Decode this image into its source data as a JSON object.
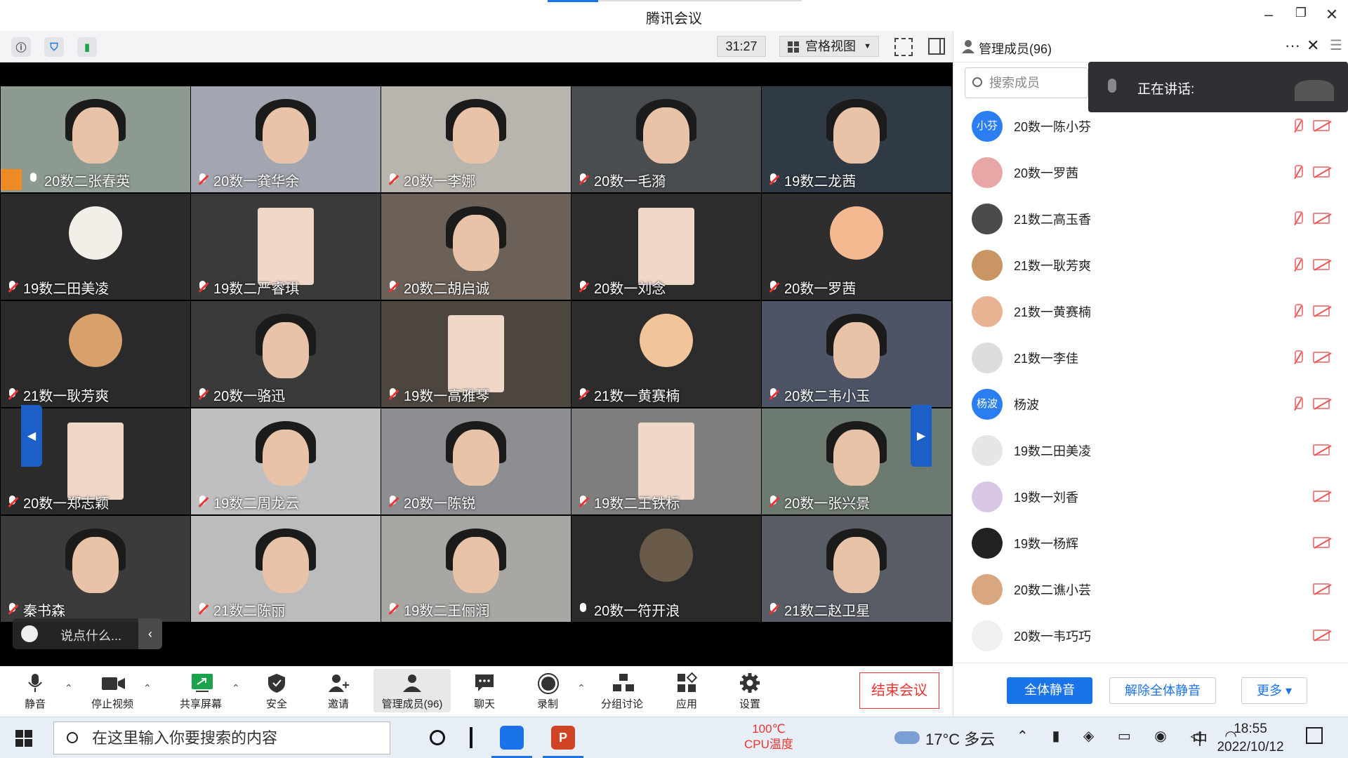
{
  "window": {
    "title": "腾讯会议",
    "min": "–",
    "max": "❐",
    "close": "✕"
  },
  "toolbar": {
    "timer": "31:27",
    "view_label": "宫格视图"
  },
  "tiles": [
    {
      "name": "20数二张春英",
      "mic": "on"
    },
    {
      "name": "20数一龚华余",
      "mic": "off"
    },
    {
      "name": "20数一李娜",
      "mic": "off"
    },
    {
      "name": "20数一毛漪",
      "mic": "off"
    },
    {
      "name": "19数二龙茜",
      "mic": "off"
    },
    {
      "name": "19数二田美凌",
      "mic": "off"
    },
    {
      "name": "19数二严睿琪",
      "mic": "off"
    },
    {
      "name": "20数二胡启诚",
      "mic": "off"
    },
    {
      "name": "20数一刘念",
      "mic": "off"
    },
    {
      "name": "20数一罗茜",
      "mic": "off"
    },
    {
      "name": "21数一耿芳爽",
      "mic": "off"
    },
    {
      "name": "20数一骆迅",
      "mic": "off"
    },
    {
      "name": "19数一高雅琴",
      "mic": "off"
    },
    {
      "name": "21数一黄赛楠",
      "mic": "off"
    },
    {
      "name": "20数二韦小玉",
      "mic": "off"
    },
    {
      "name": "20数一郑志颖",
      "mic": "off"
    },
    {
      "name": "19数二周龙云",
      "mic": "off"
    },
    {
      "name": "20数一陈锐",
      "mic": "off"
    },
    {
      "name": "19数二王铁标",
      "mic": "off"
    },
    {
      "name": "20数一张兴景",
      "mic": "off"
    },
    {
      "name": "秦书森",
      "mic": "off"
    },
    {
      "name": "21数二陈丽",
      "mic": "off"
    },
    {
      "name": "19数二王俪润",
      "mic": "off"
    },
    {
      "name": "20数一符开浪",
      "mic": "on"
    },
    {
      "name": "21数二赵卫星",
      "mic": "off"
    }
  ],
  "chat": {
    "placeholder": "说点什么..."
  },
  "controls": {
    "mute": "静音",
    "stop_video": "停止视频",
    "share": "共享屏幕",
    "security": "安全",
    "invite": "邀请",
    "members": "管理成员(96)",
    "chat": "聊天",
    "record": "录制",
    "breakout": "分组讨论",
    "apps": "应用",
    "settings": "设置",
    "end": "结束会议"
  },
  "panel": {
    "title": "管理成员(96)",
    "search_placeholder": "搜索成员",
    "speaking": "正在讲话:",
    "members": [
      {
        "name": "20数一陈小芬",
        "avatar_text": "小芬",
        "color": "#2b7ef0",
        "mic_off": true
      },
      {
        "name": "20数一罗茜",
        "avatar_text": "",
        "color": "#e9a6a6",
        "mic_off": true
      },
      {
        "name": "21数二高玉香",
        "avatar_text": "",
        "color": "#4b4b4b",
        "mic_off": true
      },
      {
        "name": "21数一耿芳爽",
        "avatar_text": "",
        "color": "#c99562",
        "mic_off": true
      },
      {
        "name": "21数一黄赛楠",
        "avatar_text": "",
        "color": "#e8b392",
        "mic_off": true
      },
      {
        "name": "21数一李佳",
        "avatar_text": "",
        "color": "#dddddd",
        "mic_off": true
      },
      {
        "name": "杨波",
        "avatar_text": "杨波",
        "color": "#2b7ef0",
        "mic_off": true
      },
      {
        "name": "19数二田美凌",
        "avatar_text": "",
        "color": "#e6e6e6",
        "mic_off": false
      },
      {
        "name": "19数一刘香",
        "avatar_text": "",
        "color": "#d9c6e6",
        "mic_off": false
      },
      {
        "name": "19数一杨辉",
        "avatar_text": "",
        "color": "#222222",
        "mic_off": false
      },
      {
        "name": "20数二谯小芸",
        "avatar_text": "",
        "color": "#d8a77f",
        "mic_off": false
      },
      {
        "name": "20数一韦巧巧",
        "avatar_text": "",
        "color": "#f0f0f0",
        "mic_off": false
      }
    ],
    "mute_all": "全体静音",
    "unmute_all": "解除全体静音",
    "more": "更多 ▾"
  },
  "taskbar": {
    "search_placeholder": "在这里输入你要搜索的内容",
    "cpu_temp": "100℃",
    "cpu_label": "CPU温度",
    "weather": "17°C  多云",
    "ime": "中",
    "time": "18:55",
    "date": "2022/10/12"
  }
}
